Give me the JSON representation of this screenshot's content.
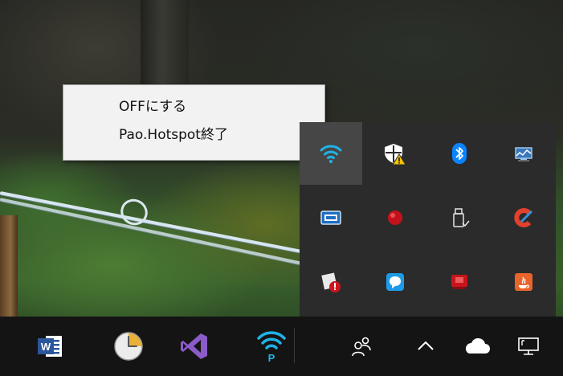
{
  "context_menu": {
    "items": [
      {
        "label": "OFFにする"
      },
      {
        "label": "Pao.Hotspot終了"
      }
    ]
  },
  "tray_overflow": {
    "icons": [
      {
        "icon": "wifi-hotspot-icon",
        "state": "hovered"
      },
      {
        "icon": "windows-security-warning-icon"
      },
      {
        "icon": "bluetooth-icon"
      },
      {
        "icon": "network-monitor-icon"
      },
      {
        "icon": "card-reader-icon"
      },
      {
        "icon": "red-ball-icon"
      },
      {
        "icon": "usb-drive-icon"
      },
      {
        "icon": "ccleaner-icon"
      },
      {
        "icon": "security-app-alert-icon"
      },
      {
        "icon": "chat-bubble-icon"
      },
      {
        "icon": "red-app-icon"
      },
      {
        "icon": "java-update-icon"
      }
    ]
  },
  "taskbar": {
    "pinned": [
      {
        "icon": "word-icon",
        "letter": "W"
      },
      {
        "icon": "clock-app-icon"
      },
      {
        "icon": "visual-studio-icon"
      },
      {
        "icon": "pao-hotspot-icon",
        "letter": "P"
      }
    ],
    "system": [
      {
        "icon": "people-icon"
      },
      {
        "icon": "show-hidden-icons-chevron"
      },
      {
        "icon": "onedrive-cloud-icon"
      },
      {
        "icon": "network-desktop-icon"
      }
    ]
  },
  "colors": {
    "taskbar_bg": "#141414",
    "flyout_bg": "#2b2b2b",
    "accent_cyan": "#1fb3e8",
    "menu_bg": "#f2f2f2"
  }
}
